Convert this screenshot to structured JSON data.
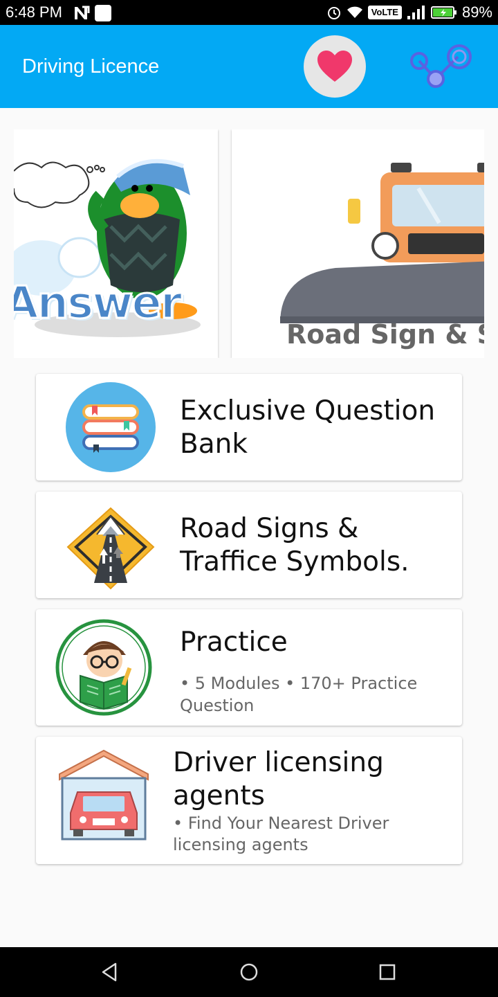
{
  "status_bar": {
    "time": "6:48 PM",
    "network_badge": "VoLTE",
    "battery": "89%"
  },
  "app_bar": {
    "title": "Driving Licence",
    "colors": {
      "background": "#03a9f4",
      "heart": "#f0386b",
      "share": "#5a62e0"
    }
  },
  "carousel": {
    "slides": [
      {
        "caption": "Answer",
        "icon": "penguin-answer-illustration"
      },
      {
        "caption": "Road Sign & Sy",
        "icon": "snowplow-truck-illustration"
      }
    ]
  },
  "menu": {
    "items": [
      {
        "title": "Exclusive Question Bank",
        "subtitle": "",
        "icon": "books-icon"
      },
      {
        "title": "Road Signs & Traffice Symbols.",
        "subtitle": "",
        "icon": "road-sign-icon"
      },
      {
        "title": "Practice",
        "subtitle": "• 5 Modules • 170+ Practice Question",
        "icon": "student-reading-icon"
      },
      {
        "title": "Driver licensing agents",
        "subtitle": "• Find Your Nearest Driver licensing agents",
        "icon": "garage-car-icon"
      }
    ]
  }
}
